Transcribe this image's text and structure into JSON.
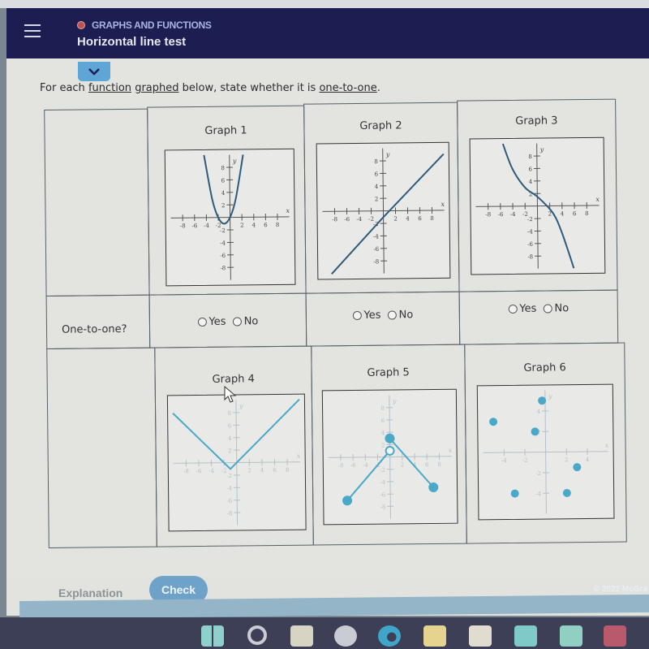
{
  "header": {
    "topic": "GRAPHS AND FUNCTIONS",
    "title": "Horizontal line test",
    "menu_icon": "hamburger-menu-icon",
    "collapse_icon": "chevron-down-icon"
  },
  "prompt": {
    "before": "For each ",
    "link1": "function",
    "space": " ",
    "link2": "graphed",
    "middle": " below, state whether it is ",
    "link3": "one-to-one",
    "end": "."
  },
  "table": {
    "row_label": "One-to-one?",
    "yes_label": "Yes",
    "no_label": "No",
    "graphs": [
      {
        "title": "Graph 1"
      },
      {
        "title": "Graph 2"
      },
      {
        "title": "Graph 3"
      },
      {
        "title": "Graph 4"
      },
      {
        "title": "Graph 5"
      },
      {
        "title": "Graph 6"
      }
    ]
  },
  "chart_data": [
    {
      "type": "line",
      "title": "Graph 1",
      "xlabel": "x",
      "ylabel": "y",
      "xlim": [
        -10,
        10
      ],
      "ylim": [
        -10,
        10
      ],
      "xticks": [
        -8,
        -6,
        -4,
        -2,
        2,
        4,
        6,
        8
      ],
      "yticks": [
        -8,
        -6,
        -4,
        -2,
        2,
        4,
        6,
        8
      ],
      "description": "upward parabola, vertex near (-1, -1)",
      "points": [
        [
          -4.3,
          10
        ],
        [
          -3,
          3
        ],
        [
          -2,
          0
        ],
        [
          -1,
          -1
        ],
        [
          0,
          0
        ],
        [
          1,
          3
        ],
        [
          2.3,
          10
        ]
      ]
    },
    {
      "type": "line",
      "title": "Graph 2",
      "xlabel": "x",
      "ylabel": "y",
      "xlim": [
        -10,
        10
      ],
      "ylim": [
        -10,
        10
      ],
      "xticks": [
        -8,
        -6,
        -4,
        -2,
        2,
        4,
        6,
        8
      ],
      "yticks": [
        -8,
        -6,
        -4,
        -2,
        2,
        4,
        6,
        8
      ],
      "description": "straight line through (-8.6, -10) and (10, 9)",
      "points": [
        [
          -8.6,
          -10
        ],
        [
          0,
          -1
        ],
        [
          1,
          0
        ],
        [
          10,
          9
        ]
      ]
    },
    {
      "type": "line",
      "title": "Graph 3",
      "xlabel": "x",
      "ylabel": "y",
      "xlim": [
        -10,
        10
      ],
      "ylim": [
        -10,
        10
      ],
      "xticks": [
        -8,
        -6,
        -4,
        -2,
        2,
        4,
        6,
        8
      ],
      "yticks": [
        -8,
        -6,
        -4,
        -2,
        2,
        4,
        6,
        8
      ],
      "description": "decreasing cubic-like curve",
      "points": [
        [
          -5.5,
          10
        ],
        [
          -4,
          6
        ],
        [
          -2,
          3
        ],
        [
          0,
          1.5
        ],
        [
          2,
          -0.5
        ],
        [
          3,
          -2
        ],
        [
          4,
          -4.5
        ],
        [
          5,
          -7.5
        ],
        [
          5.8,
          -10
        ]
      ]
    },
    {
      "type": "line",
      "title": "Graph 4",
      "xlabel": "x",
      "ylabel": "y",
      "xlim": [
        -10,
        10
      ],
      "ylim": [
        -10,
        10
      ],
      "xticks": [
        -8,
        -6,
        -4,
        -2,
        2,
        4,
        6,
        8
      ],
      "yticks": [
        -8,
        -6,
        -4,
        -2,
        2,
        4,
        6,
        8
      ],
      "description": "V-shaped absolute value graph, vertex at (-1, -1)",
      "points": [
        [
          -10,
          8
        ],
        [
          -1,
          -1
        ],
        [
          10,
          10
        ]
      ]
    },
    {
      "type": "line",
      "title": "Graph 5",
      "xlabel": "x",
      "ylabel": "y",
      "xlim": [
        -10,
        10
      ],
      "ylim": [
        -10,
        10
      ],
      "xticks": [
        -8,
        -6,
        -4,
        -2,
        2,
        4,
        6,
        8
      ],
      "yticks": [
        -8,
        -6,
        -4,
        -2,
        2,
        4,
        6,
        8
      ],
      "description": "two segments: open circle at (0,1) down to closed (-7,-7); closed (0,3) down to closed (7,-5)",
      "segments": [
        {
          "from": [
            -7,
            -7
          ],
          "to": [
            0,
            1
          ],
          "from_closed": true,
          "to_closed": false
        },
        {
          "from": [
            0,
            3
          ],
          "to": [
            7,
            -5
          ],
          "from_closed": true,
          "to_closed": true
        }
      ]
    },
    {
      "type": "scatter",
      "title": "Graph 6",
      "xlabel": "x",
      "ylabel": "y",
      "xlim": [
        -6,
        6
      ],
      "ylim": [
        -6,
        6
      ],
      "xticks": [
        -4,
        -2,
        2,
        4
      ],
      "yticks": [
        -4,
        -2,
        2,
        4
      ],
      "points": [
        [
          -5,
          3
        ],
        [
          -1,
          2
        ],
        [
          -0.3,
          5
        ],
        [
          -3,
          -4
        ],
        [
          2,
          -4
        ],
        [
          3,
          -1.5
        ]
      ]
    }
  ],
  "footer": {
    "explanation_label": "Explanation",
    "check_label": "Check",
    "copyright": "© 2022 McGra"
  },
  "taskbar": {
    "icons": [
      "windows-start-icon",
      "search-icon",
      "task-view-icon",
      "widgets-icon",
      "edge-browser-icon",
      "file-explorer-icon",
      "microsoft-store-icon",
      "mail-icon",
      "launcher-l-icon",
      "mcafee-icon"
    ]
  },
  "colors": {
    "header_bg": "#1c1e52",
    "curve_dark": "#2f5a7a",
    "curve_light": "#4aa8c8",
    "check_button": "#6ea2c8"
  }
}
